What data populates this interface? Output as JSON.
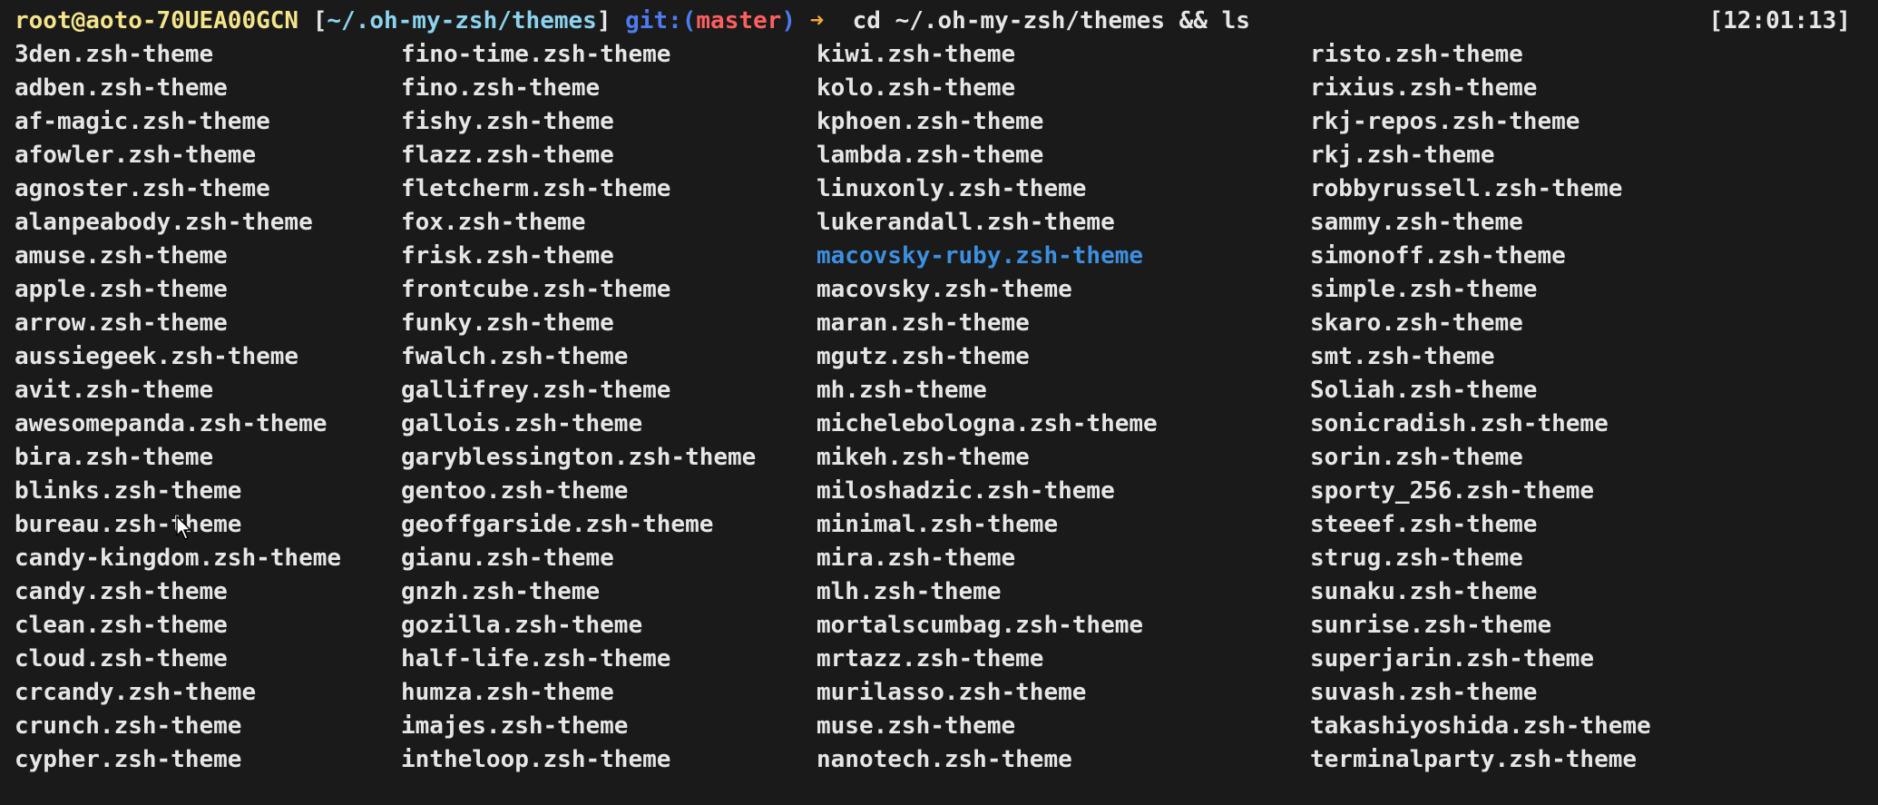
{
  "prompt": {
    "user_host": "root@aoto-70UEA00GCN",
    "bracket_open": " [",
    "path": "~/.oh-my-zsh/themes",
    "bracket_close": "] ",
    "git_label": "git:(",
    "branch": "master",
    "git_close": ")",
    "arrow": " ➜ ",
    "command": " cd ~/.oh-my-zsh/themes && ls",
    "timestamp": "[12:01:13]"
  },
  "colors": {
    "background": "#1a1a1a",
    "text": "#e6e6e6",
    "user_host": "#f4e48a",
    "path": "#8bd3ee",
    "git": "#4c7cf0",
    "branch": "#ff5f5f",
    "arrow": "#f2a93b",
    "highlighted_file": "#3d8fe0"
  },
  "columns": [
    [
      "3den.zsh-theme",
      "adben.zsh-theme",
      "af-magic.zsh-theme",
      "afowler.zsh-theme",
      "agnoster.zsh-theme",
      "alanpeabody.zsh-theme",
      "amuse.zsh-theme",
      "apple.zsh-theme",
      "arrow.zsh-theme",
      "aussiegeek.zsh-theme",
      "avit.zsh-theme",
      "awesomepanda.zsh-theme",
      "bira.zsh-theme",
      "blinks.zsh-theme",
      "bureau.zsh-theme",
      "candy-kingdom.zsh-theme",
      "candy.zsh-theme",
      "clean.zsh-theme",
      "cloud.zsh-theme",
      "crcandy.zsh-theme",
      "crunch.zsh-theme",
      "cypher.zsh-theme"
    ],
    [
      "fino-time.zsh-theme",
      "fino.zsh-theme",
      "fishy.zsh-theme",
      "flazz.zsh-theme",
      "fletcherm.zsh-theme",
      "fox.zsh-theme",
      "frisk.zsh-theme",
      "frontcube.zsh-theme",
      "funky.zsh-theme",
      "fwalch.zsh-theme",
      "gallifrey.zsh-theme",
      "gallois.zsh-theme",
      "garyblessington.zsh-theme",
      "gentoo.zsh-theme",
      "geoffgarside.zsh-theme",
      "gianu.zsh-theme",
      "gnzh.zsh-theme",
      "gozilla.zsh-theme",
      "half-life.zsh-theme",
      "humza.zsh-theme",
      "imajes.zsh-theme",
      "intheloop.zsh-theme"
    ],
    [
      "kiwi.zsh-theme",
      "kolo.zsh-theme",
      "kphoen.zsh-theme",
      "lambda.zsh-theme",
      "linuxonly.zsh-theme",
      "lukerandall.zsh-theme",
      "macovsky-ruby.zsh-theme",
      "macovsky.zsh-theme",
      "maran.zsh-theme",
      "mgutz.zsh-theme",
      "mh.zsh-theme",
      "michelebologna.zsh-theme",
      "mikeh.zsh-theme",
      "miloshadzic.zsh-theme",
      "minimal.zsh-theme",
      "mira.zsh-theme",
      "mlh.zsh-theme",
      "mortalscumbag.zsh-theme",
      "mrtazz.zsh-theme",
      "murilasso.zsh-theme",
      "muse.zsh-theme",
      "nanotech.zsh-theme"
    ],
    [
      "risto.zsh-theme",
      "rixius.zsh-theme",
      "rkj-repos.zsh-theme",
      "rkj.zsh-theme",
      "robbyrussell.zsh-theme",
      "sammy.zsh-theme",
      "simonoff.zsh-theme",
      "simple.zsh-theme",
      "skaro.zsh-theme",
      "smt.zsh-theme",
      "Soliah.zsh-theme",
      "sonicradish.zsh-theme",
      "sorin.zsh-theme",
      "sporty_256.zsh-theme",
      "steeef.zsh-theme",
      "strug.zsh-theme",
      "sunaku.zsh-theme",
      "sunrise.zsh-theme",
      "superjarin.zsh-theme",
      "suvash.zsh-theme",
      "takashiyoshida.zsh-theme",
      "terminalparty.zsh-theme"
    ]
  ],
  "highlighted_file": "macovsky-ruby.zsh-theme",
  "cursor_icon": "mouse-pointer-icon"
}
